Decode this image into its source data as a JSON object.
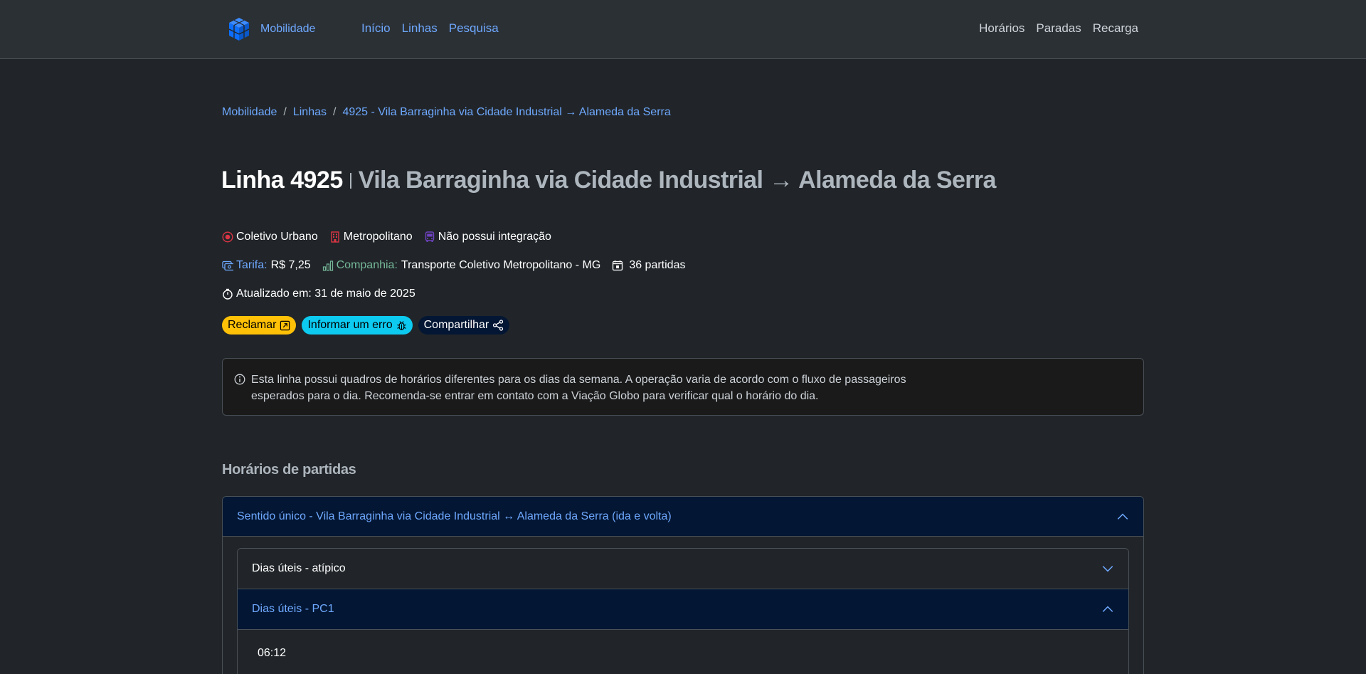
{
  "navbar": {
    "brand": "Mobilidade",
    "left_links": [
      "Início",
      "Linhas",
      "Pesquisa"
    ],
    "right_links": [
      "Horários",
      "Paradas",
      "Recarga"
    ],
    "brand_color": "#0d6efd",
    "link_color": "#6ea8fe"
  },
  "breadcrumb": [
    "Mobilidade",
    "Linhas",
    "4925 - Vila Barraginha via Cidade Industrial → Alameda da Serra"
  ],
  "title": {
    "line": "Linha 4925",
    "route": "Vila Barraginha via Cidade Industrial → Alameda da Serra"
  },
  "meta": {
    "type": "Coletivo Urbano",
    "scope": "Metropolitano",
    "integration": "Não possui integração",
    "fare_label": "Tarifa:",
    "fare_value": "R$ 7,25",
    "company_label": "Companhia:",
    "company_value": "Transporte Coletivo Metropolitano - MG",
    "departures": "36 partidas",
    "updated": "Atualizado em: 31 de maio de 2025",
    "icons": [
      "record-circle-icon",
      "building-icon",
      "bus-icon",
      "ticket-icon",
      "bar-chart-icon",
      "calendar-icon",
      "stopwatch-icon"
    ],
    "colors": {
      "red": "#dc3545",
      "purple": "#6f42c1",
      "blue": "#6ea8fe",
      "green": "#75b798"
    }
  },
  "actions": {
    "complain": "Reclamar",
    "report_error": "Informar um erro",
    "share": "Compartilhar"
  },
  "alert": {
    "text": "Esta linha possui quadros de horários diferentes para os dias da semana. A operação varia de acordo com o fluxo de passageiros esperados para o dia. Recomenda-se entrar em contato com a Viação Globo para verificar qual o horário do dia."
  },
  "schedule": {
    "heading": "Horários de partidas",
    "direction": "Sentido único - Vila Barraginha via Cidade Industrial ↔ Alameda da Serra (ida e volta)",
    "groups": [
      {
        "label": "Dias úteis - atípico",
        "expanded": false
      },
      {
        "label": "Dias úteis - PC1",
        "expanded": true
      }
    ],
    "times": [
      "06:12"
    ]
  }
}
